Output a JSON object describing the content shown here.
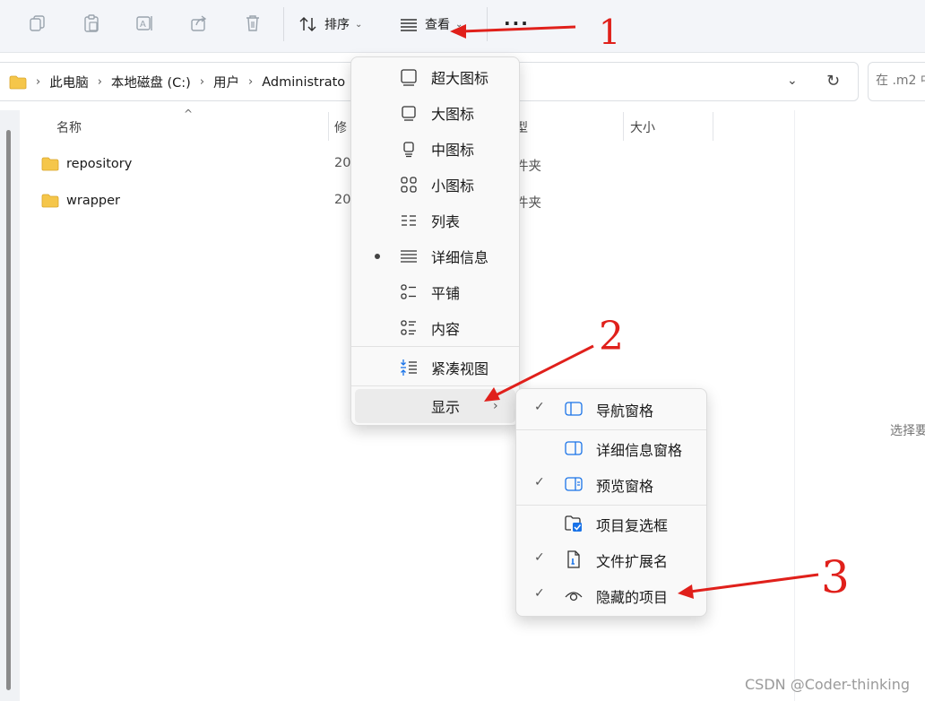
{
  "toolbar": {
    "sort_label": "排序",
    "view_label": "查看",
    "icons": [
      "copy-icon",
      "paste-icon",
      "rename-icon",
      "share-icon",
      "delete-icon"
    ]
  },
  "address": {
    "crumbs": [
      "此电脑",
      "本地磁盘 (C:)",
      "用户",
      "Administrato"
    ],
    "search_placeholder": "在 .m2 中"
  },
  "columns": {
    "name": "名称",
    "modified": "修",
    "type": "型",
    "size": "大小"
  },
  "files": [
    {
      "name": "repository",
      "date": "20",
      "type": "件夹"
    },
    {
      "name": "wrapper",
      "date": "20",
      "type": "件夹"
    }
  ],
  "view_menu": {
    "items": [
      {
        "label": "超大图标",
        "icon": "extra-large-icons-icon",
        "selected": false
      },
      {
        "label": "大图标",
        "icon": "large-icons-icon",
        "selected": false
      },
      {
        "label": "中图标",
        "icon": "medium-icons-icon",
        "selected": false
      },
      {
        "label": "小图标",
        "icon": "small-icons-icon",
        "selected": false
      },
      {
        "label": "列表",
        "icon": "list-icon",
        "selected": false
      },
      {
        "label": "详细信息",
        "icon": "details-icon",
        "selected": true
      },
      {
        "label": "平铺",
        "icon": "tiles-icon",
        "selected": false
      },
      {
        "label": "内容",
        "icon": "content-icon",
        "selected": false
      }
    ],
    "compact_label": "紧凑视图",
    "show_label": "显示"
  },
  "show_menu": {
    "items": [
      {
        "label": "导航窗格",
        "checked": true,
        "icon": "navigation-pane-icon"
      },
      {
        "label": "详细信息窗格",
        "checked": false,
        "icon": "details-pane-icon"
      },
      {
        "label": "预览窗格",
        "checked": true,
        "icon": "preview-pane-icon"
      },
      {
        "label": "项目复选框",
        "checked": false,
        "icon": "item-checkbox-icon"
      },
      {
        "label": "文件扩展名",
        "checked": true,
        "icon": "file-extension-icon"
      },
      {
        "label": "隐藏的项目",
        "checked": true,
        "icon": "hidden-items-icon"
      }
    ]
  },
  "preview_text": "选择要",
  "annotations": [
    "1",
    "2",
    "3"
  ],
  "watermark": "CSDN @Coder-thinking",
  "colors": {
    "annotation": "#e0201b",
    "folder": "#f5c64a",
    "accent": "#1a73e8"
  }
}
